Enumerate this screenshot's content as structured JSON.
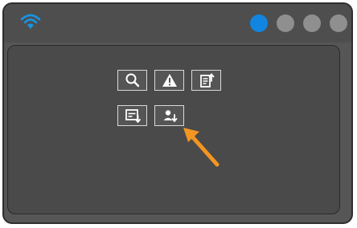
{
  "window": {
    "status_icon": "wifi-icon",
    "page_indicator": {
      "count": 4,
      "active_index": 0,
      "active_color": "#1185e0",
      "inactive_color": "#8f8f8f"
    }
  },
  "toolbar": {
    "buttons": [
      {
        "icon": "search-icon"
      },
      {
        "icon": "warning-icon"
      },
      {
        "icon": "document-upload-icon"
      },
      {
        "icon": "card-download-icon"
      },
      {
        "icon": "user-download-icon"
      }
    ]
  },
  "annotation": {
    "icon": "pointer-arrow-icon",
    "color": "#f29522",
    "target": "user-download-button"
  }
}
